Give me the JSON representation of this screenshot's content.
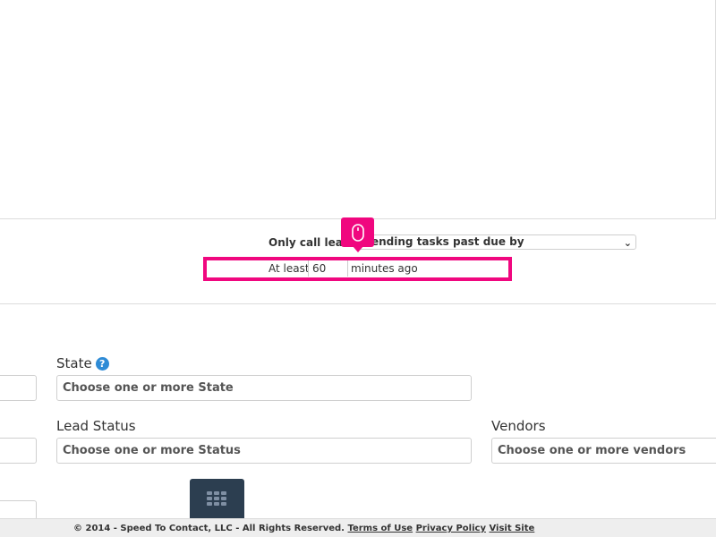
{
  "filters": {
    "only_call_label": "Only call leads",
    "due_select_value": "ending tasks past due by",
    "at_least_label": "At least",
    "minutes_value": "60",
    "minutes_suffix": "minutes ago"
  },
  "form": {
    "state_label": "State",
    "state_placeholder": "Choose one or more State",
    "status_label": "Lead Status",
    "status_placeholder": "Choose one or more Status",
    "vendors_label": "Vendors",
    "vendors_placeholder": "Choose one or more vendors"
  },
  "footer": {
    "copyright": "© 2014 - Speed To Contact, LLC - All Rights Reserved.",
    "terms_link": "Terms of Use",
    "privacy_link": "Privacy Policy",
    "visit_link": "Visit Site"
  },
  "colors": {
    "highlight": "#f0077f",
    "help_icon": "#2e8bd6",
    "grid_button": "#2c3e50"
  },
  "icons": {
    "mouse_badge": "mouse-icon",
    "help": "help-icon",
    "grid": "grid-icon",
    "chevron": "chevron-down-icon"
  }
}
